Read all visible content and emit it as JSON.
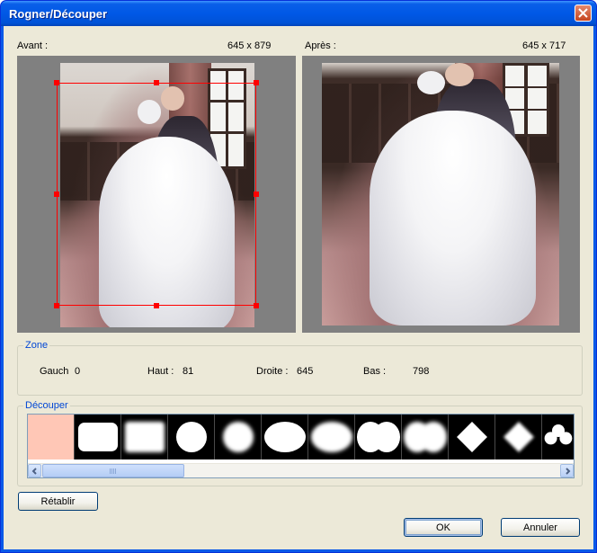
{
  "window": {
    "title": "Rogner/Découper"
  },
  "before": {
    "label": "Avant :",
    "size": "645 x 879"
  },
  "after": {
    "label": "Après :",
    "size": "645 x 717"
  },
  "zone": {
    "legend": "Zone",
    "left_label": "Gauch",
    "left_value": "0",
    "top_label": "Haut :",
    "top_value": "81",
    "right_label": "Droite :",
    "right_value": "645",
    "bottom_label": "Bas :",
    "bottom_value": "798"
  },
  "cut": {
    "legend": "Découper",
    "shapes": [
      "none",
      "rounded-rect",
      "soft-rect",
      "circle",
      "soft-circle",
      "ellipse",
      "soft-ellipse",
      "double-circle",
      "soft-double-circle",
      "diamond",
      "soft-diamond",
      "club"
    ],
    "selected_index": 0,
    "scroll_position": 0.0
  },
  "buttons": {
    "reset": "Rétablir",
    "ok": "OK",
    "cancel": "Annuler"
  },
  "colors": {
    "title_bar": "#0058e6",
    "crop_frame": "#ff0000",
    "legend_text": "#0046d5",
    "selected_shape": "#ffc7b6",
    "dialog_bg": "#ece9d8"
  }
}
